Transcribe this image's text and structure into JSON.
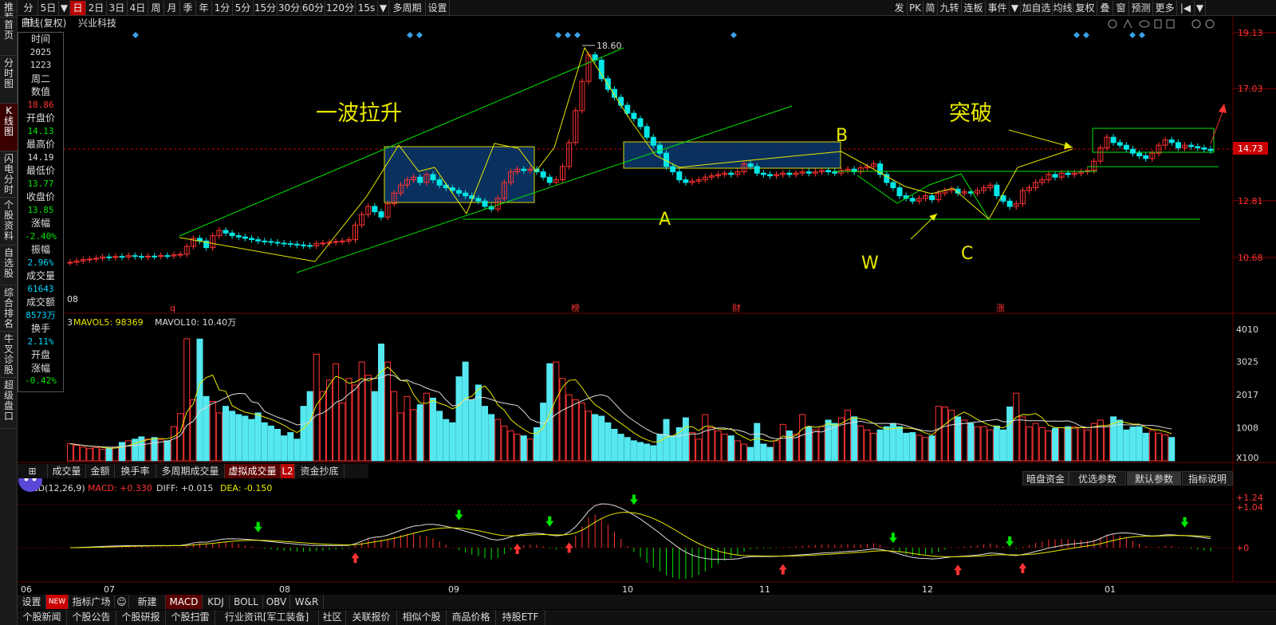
{
  "leftnav": [
    "推荐",
    "首页",
    "分时图",
    "K线图",
    "闪电分时",
    "个股资料",
    "自选股",
    "综合排名",
    "牛叉诊股",
    "超级盘口"
  ],
  "toolbar": {
    "left": [
      "分时",
      "5日",
      "▼",
      "日",
      "2日",
      "3日",
      "4日",
      "周",
      "月",
      "季",
      "年",
      "1分",
      "5分",
      "15分",
      "30分",
      "60分",
      "120分",
      "15s",
      "▼",
      "多周期",
      "设置"
    ],
    "right": [
      "发",
      "PK",
      "简",
      "九转",
      "连板",
      "事件",
      "▼",
      "加自选",
      "均线",
      "复权",
      "叠",
      "窗",
      "预测",
      "更多",
      "|◀",
      "▼"
    ]
  },
  "stock": {
    "title": "日线(复权)",
    "name": "兴业科技"
  },
  "sidepanel": [
    {
      "t": "时间",
      "c": "white"
    },
    {
      "t": "2025",
      "c": "white",
      "n": 1
    },
    {
      "t": "1223",
      "c": "white",
      "n": 1
    },
    {
      "t": "周二",
      "c": "white"
    },
    {
      "t": "数值",
      "c": "white"
    },
    {
      "t": "18.86",
      "c": "red",
      "n": 1
    },
    {
      "t": "开盘价",
      "c": "white"
    },
    {
      "t": "14.13",
      "c": "green",
      "n": 1
    },
    {
      "t": "最高价",
      "c": "white"
    },
    {
      "t": "14.19",
      "c": "white",
      "n": 1
    },
    {
      "t": "最低价",
      "c": "white"
    },
    {
      "t": "13.77",
      "c": "green",
      "n": 1
    },
    {
      "t": "收盘价",
      "c": "white"
    },
    {
      "t": "13.85",
      "c": "green",
      "n": 1
    },
    {
      "t": "涨幅",
      "c": "white"
    },
    {
      "t": "-2.40%",
      "c": "green",
      "n": 1
    },
    {
      "t": "振幅",
      "c": "white"
    },
    {
      "t": "2.96%",
      "c": "cyan",
      "n": 1
    },
    {
      "t": "成交量",
      "c": "white"
    },
    {
      "t": "61643",
      "c": "cyan",
      "n": 1
    },
    {
      "t": "成交额",
      "c": "white"
    },
    {
      "t": "8573万",
      "c": "cyan",
      "n": 1
    },
    {
      "t": "换手",
      "c": "white"
    },
    {
      "t": "2.11%",
      "c": "cyan",
      "n": 1
    },
    {
      "t": "开盘",
      "c": "white"
    },
    {
      "t": "涨幅",
      "c": "white"
    },
    {
      "t": "-0.42%",
      "c": "green",
      "n": 1
    }
  ],
  "price_axis": {
    "ticks": [
      "19.13",
      "17.03",
      "14.73",
      "12.81",
      "10.68"
    ],
    "current": "14.73",
    "high_label": "18.60",
    "first_date": "08"
  },
  "annotations": {
    "wave": "一波拉升",
    "breakout": "突破",
    "A": "A",
    "B": "B",
    "C": "C",
    "W": "W"
  },
  "event_marks": [
    "q",
    "榜",
    "财",
    "涨"
  ],
  "vol": {
    "legend1": "3",
    "ma5_label": "MAVOL5: 98369",
    "ma10_label": "MAVOL10: 10.40万",
    "axis": [
      "4010",
      "3025",
      "2017",
      "1008",
      "X100"
    ]
  },
  "subtabs": [
    "⊞",
    "成交量",
    "金额",
    "换手率",
    "多周期成交量",
    "虚拟成交量",
    "L2",
    "资金抄底"
  ],
  "macd": {
    "label": "CD(12,26,9)",
    "macd_v": "MACD: +0.330",
    "diff_v": "DIFF: +0.015",
    "dea_v": "DEA: -0.150",
    "axis": [
      "+1.24",
      "+1.04",
      "+0"
    ],
    "buttons": [
      "暗盘资金",
      "优选参数",
      "默认参数",
      "指标说明"
    ]
  },
  "months": [
    "06",
    "07",
    "08",
    "09",
    "10",
    "11",
    "12",
    "01"
  ],
  "bottomtabs": [
    "设置",
    "NEW",
    "指标广场",
    "☺",
    "新建",
    "MACD",
    "KDJ",
    "BOLL",
    "OBV",
    "W&R"
  ],
  "newsbar": [
    "个股新闻",
    "个股公告",
    "个股研报",
    "个股扫雷",
    "行业资讯[军工装备]",
    "社区",
    "关联报价",
    "相似个股",
    "商品价格",
    "持股ETF"
  ],
  "chart_data": {
    "type": "candlestick",
    "stock": "兴业科技",
    "x_months": [
      "06",
      "07",
      "08",
      "09",
      "10",
      "11",
      "12",
      "01"
    ],
    "closes": [
      10.5,
      10.55,
      10.6,
      10.62,
      10.65,
      10.7,
      10.68,
      10.72,
      10.7,
      10.75,
      10.72,
      10.7,
      10.73,
      10.72,
      10.75,
      10.74,
      10.78,
      10.8,
      11.1,
      11.4,
      11.3,
      11.05,
      11.5,
      11.7,
      11.6,
      11.5,
      11.45,
      11.4,
      11.35,
      11.3,
      11.28,
      11.25,
      11.22,
      11.2,
      11.18,
      11.15,
      11.13,
      11.12,
      11.2,
      11.22,
      11.25,
      11.28,
      11.3,
      11.35,
      11.9,
      12.3,
      12.6,
      12.4,
      12.2,
      12.7,
      13.1,
      13.4,
      13.6,
      13.7,
      13.5,
      13.8,
      13.6,
      13.4,
      13.3,
      13.2,
      13.1,
      13.0,
      12.9,
      12.8,
      12.6,
      12.5,
      12.9,
      13.5,
      13.9,
      14.0,
      13.95,
      14.0,
      13.9,
      13.7,
      13.5,
      13.6,
      14.1,
      15.0,
      16.2,
      17.3,
      18.3,
      18.1,
      17.4,
      17.0,
      16.7,
      16.4,
      16.1,
      15.9,
      15.6,
      15.2,
      14.9,
      14.6,
      14.1,
      13.9,
      13.6,
      13.5,
      13.55,
      13.6,
      13.7,
      13.75,
      13.8,
      13.85,
      13.8,
      13.9,
      14.2,
      14.1,
      13.85,
      13.8,
      13.75,
      13.8,
      13.85,
      13.8,
      13.85,
      13.9,
      13.85,
      13.9,
      13.95,
      13.9,
      13.85,
      13.95,
      14.0,
      13.9,
      14.05,
      14.1,
      14.2,
      13.8,
      13.5,
      13.3,
      13.0,
      12.9,
      12.8,
      12.9,
      13.0,
      12.85,
      13.1,
      13.2,
      13.25,
      13.1,
      13.15,
      13.1,
      13.2,
      13.3,
      13.4,
      13.0,
      12.8,
      12.6,
      12.7,
      13.2,
      13.3,
      13.5,
      13.6,
      13.8,
      13.7,
      13.85,
      13.8,
      13.85,
      13.9,
      13.95,
      14.3,
      14.8,
      15.2,
      15.0,
      14.9,
      14.75,
      14.6,
      14.5,
      14.4,
      14.6,
      14.9,
      15.1,
      15.0,
      14.8,
      14.9,
      14.85,
      14.8,
      14.75,
      14.7
    ],
    "volumes": [
      520,
      470,
      420,
      380,
      400,
      350,
      380,
      420,
      560,
      610,
      660,
      730,
      660,
      710,
      640,
      610,
      1040,
      1440,
      3720,
      1860,
      3710,
      1960,
      1810,
      1460,
      1660,
      1510,
      1410,
      1360,
      1260,
      1460,
      1160,
      1060,
      960,
      760,
      860,
      660,
      1660,
      2110,
      3250,
      2110,
      2460,
      2960,
      1760,
      2510,
      2310,
      3010,
      2610,
      2110,
      3560,
      3010,
      2110,
      1460,
      1960,
      1560,
      1710,
      2060,
      1910,
      1510,
      1260,
      1160,
      2560,
      3010,
      1860,
      2310,
      1660,
      1410,
      1260,
      1060,
      910,
      810,
      760,
      660,
      1010,
      1760,
      2960,
      3010,
      2510,
      2010,
      1860,
      1760,
      1510,
      1410,
      1360,
      1160,
      960,
      810,
      710,
      610,
      560,
      510,
      460,
      810,
      1260,
      760,
      1010,
      1310,
      860,
      660,
      1410,
      1010,
      910,
      810,
      760,
      610,
      510,
      410,
      1140,
      510,
      410,
      610,
      1110,
      910,
      810,
      1410,
      1040,
      940,
      1040,
      1240,
      1140,
      1310,
      1540,
      1340,
      1060,
      940,
      840,
      940,
      1040,
      1140,
      1040,
      840,
      860,
      780,
      710,
      760,
      1660,
      1640,
      1540,
      1340,
      1240,
      1140,
      1030,
      1040,
      940,
      1060,
      940,
      1640,
      2060,
      1340,
      1030,
      1140,
      1010,
      910,
      990,
      1010,
      1040,
      1030,
      1010,
      940,
      1140,
      1240,
      1040,
      1340,
      1240,
      940,
      1030,
      1040,
      840,
      940,
      840,
      790,
      710
    ],
    "ma_levels": {
      "box1_top": 14.0,
      "box1_bottom": 12.7,
      "box2_top": 14.2,
      "box2_bottom": 13.6,
      "support_A": 12.3,
      "high": 18.6
    }
  }
}
